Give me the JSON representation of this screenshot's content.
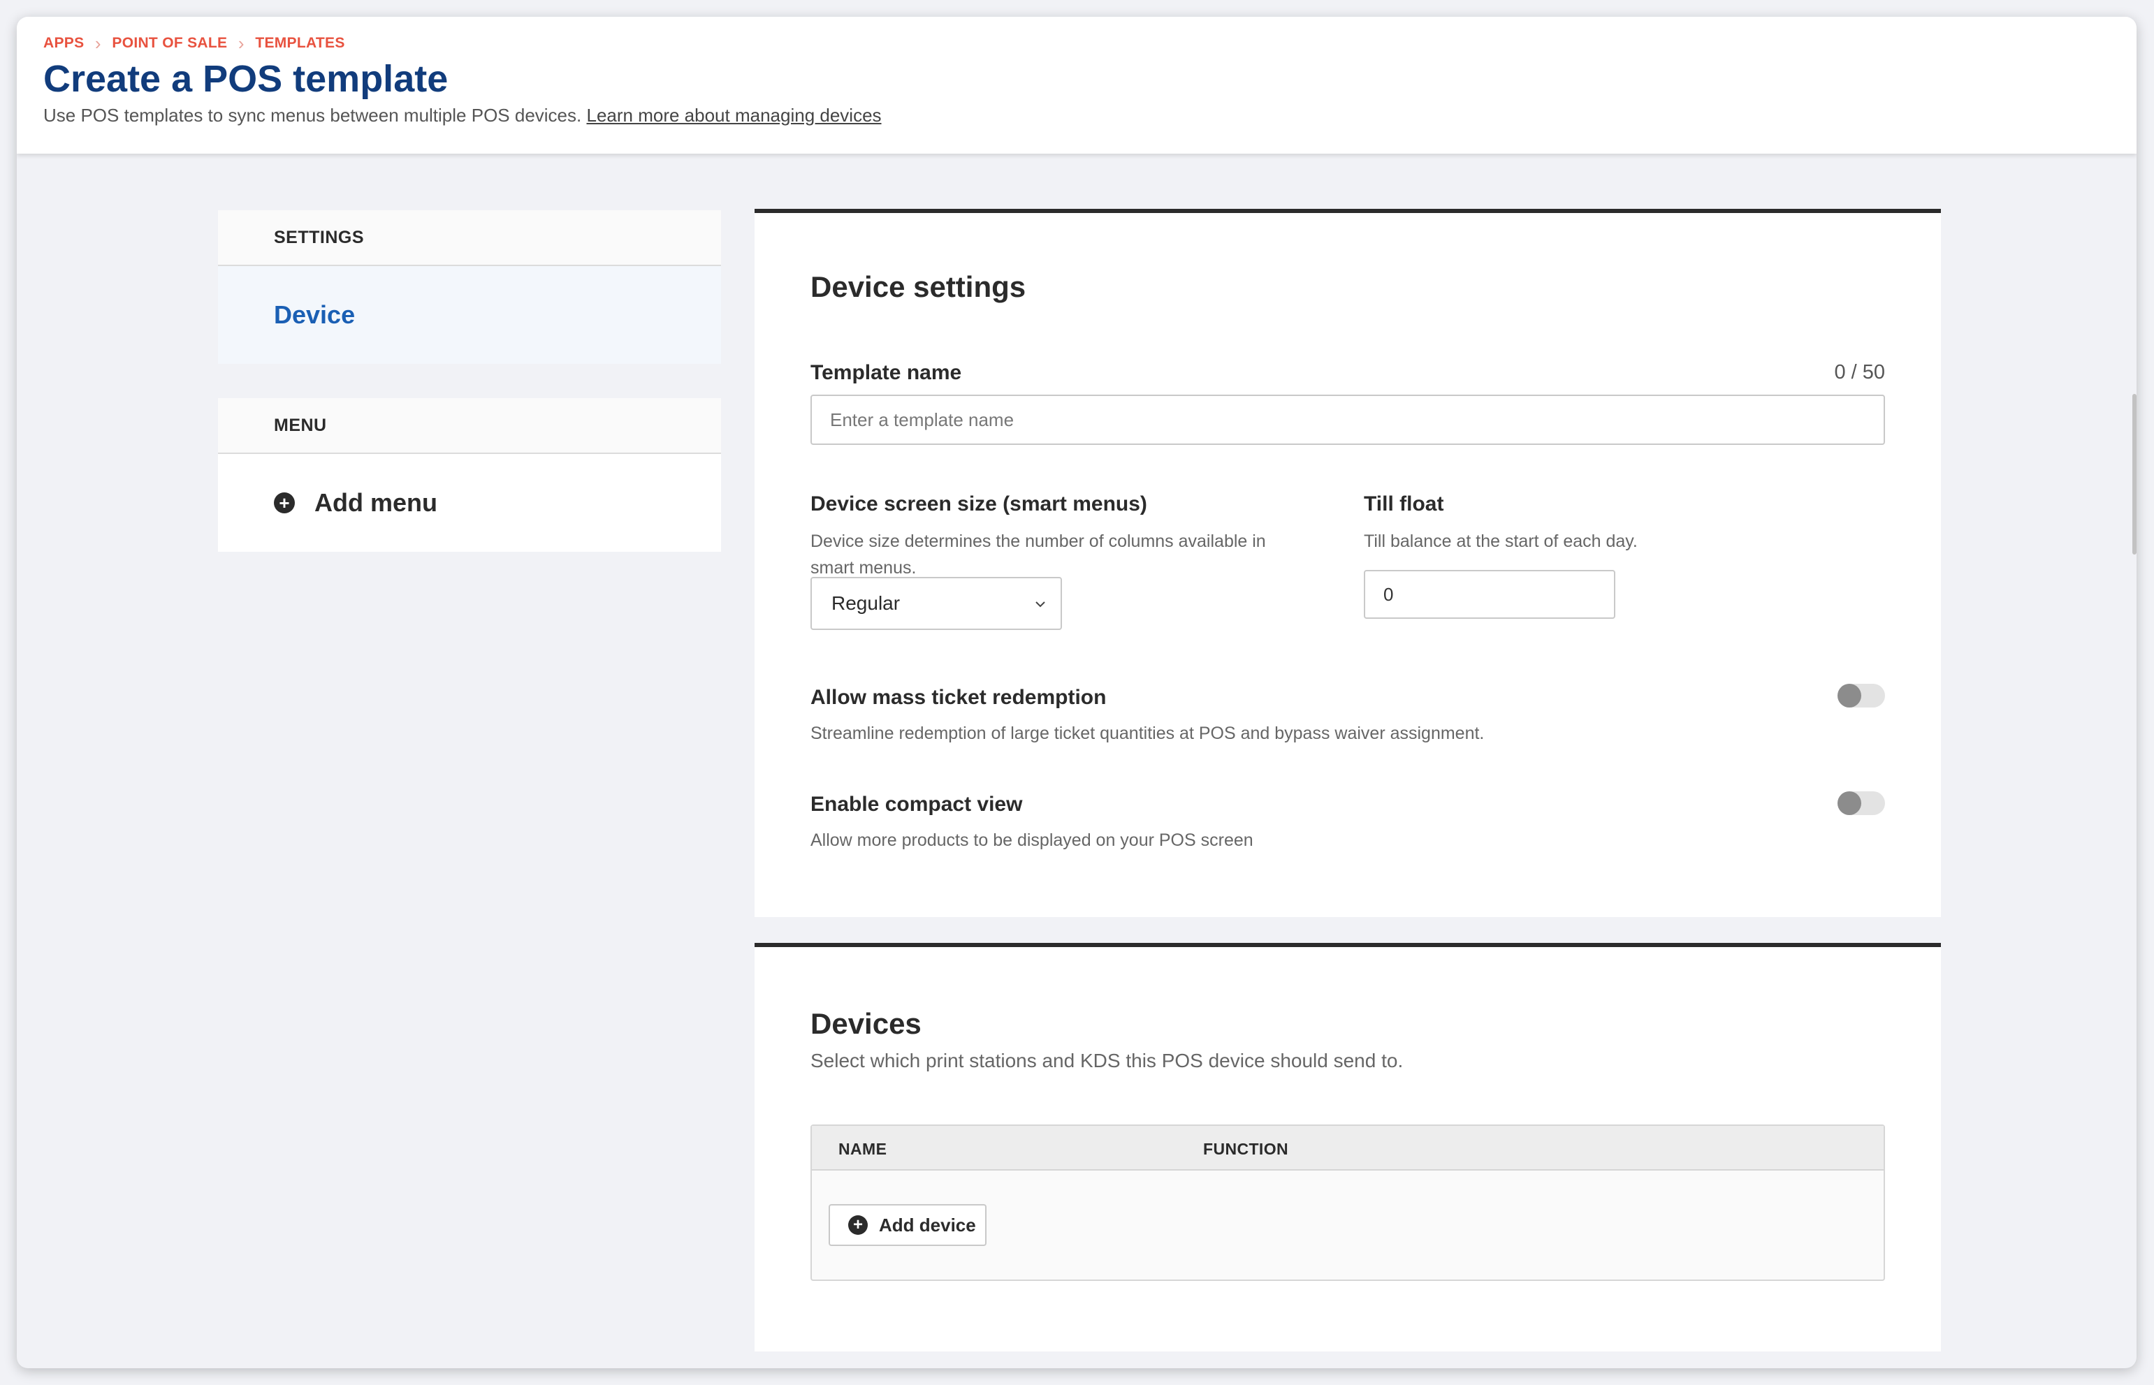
{
  "breadcrumb": [
    "APPS",
    "POINT OF SALE",
    "TEMPLATES"
  ],
  "header": {
    "title": "Create a POS template",
    "subtitle": "Use POS templates to sync menus between multiple POS devices.",
    "learn_more": "Learn more about managing devices"
  },
  "sidebar": {
    "settings_heading": "SETTINGS",
    "settings_item": "Device",
    "menu_heading": "MENU",
    "add_menu": "Add menu"
  },
  "device_settings": {
    "title": "Device settings",
    "template_name_label": "Template name",
    "template_name_counter": "0 / 50",
    "template_name_placeholder": "Enter a template name",
    "template_name_value": "",
    "screen_size_label": "Device screen size (smart menus)",
    "screen_size_help": "Device size determines the number of columns available in smart menus.",
    "screen_size_value": "Regular",
    "till_float_label": "Till float",
    "till_float_help": "Till balance at the start of each day.",
    "till_float_value": "0",
    "mass_ticket_label": "Allow mass ticket redemption",
    "mass_ticket_help": "Streamline redemption of large ticket quantities at POS and bypass waiver assignment.",
    "mass_ticket_on": false,
    "compact_label": "Enable compact view",
    "compact_help": "Allow more products to be displayed on your POS screen",
    "compact_on": false
  },
  "devices": {
    "title": "Devices",
    "help": "Select which print stations and KDS this POS device should send to.",
    "columns": [
      "NAME",
      "FUNCTION"
    ],
    "add_device": "Add device"
  },
  "colors": {
    "accent": "#1a5fb4",
    "title": "#113c7c",
    "breadcrumb": "#e8523f"
  }
}
